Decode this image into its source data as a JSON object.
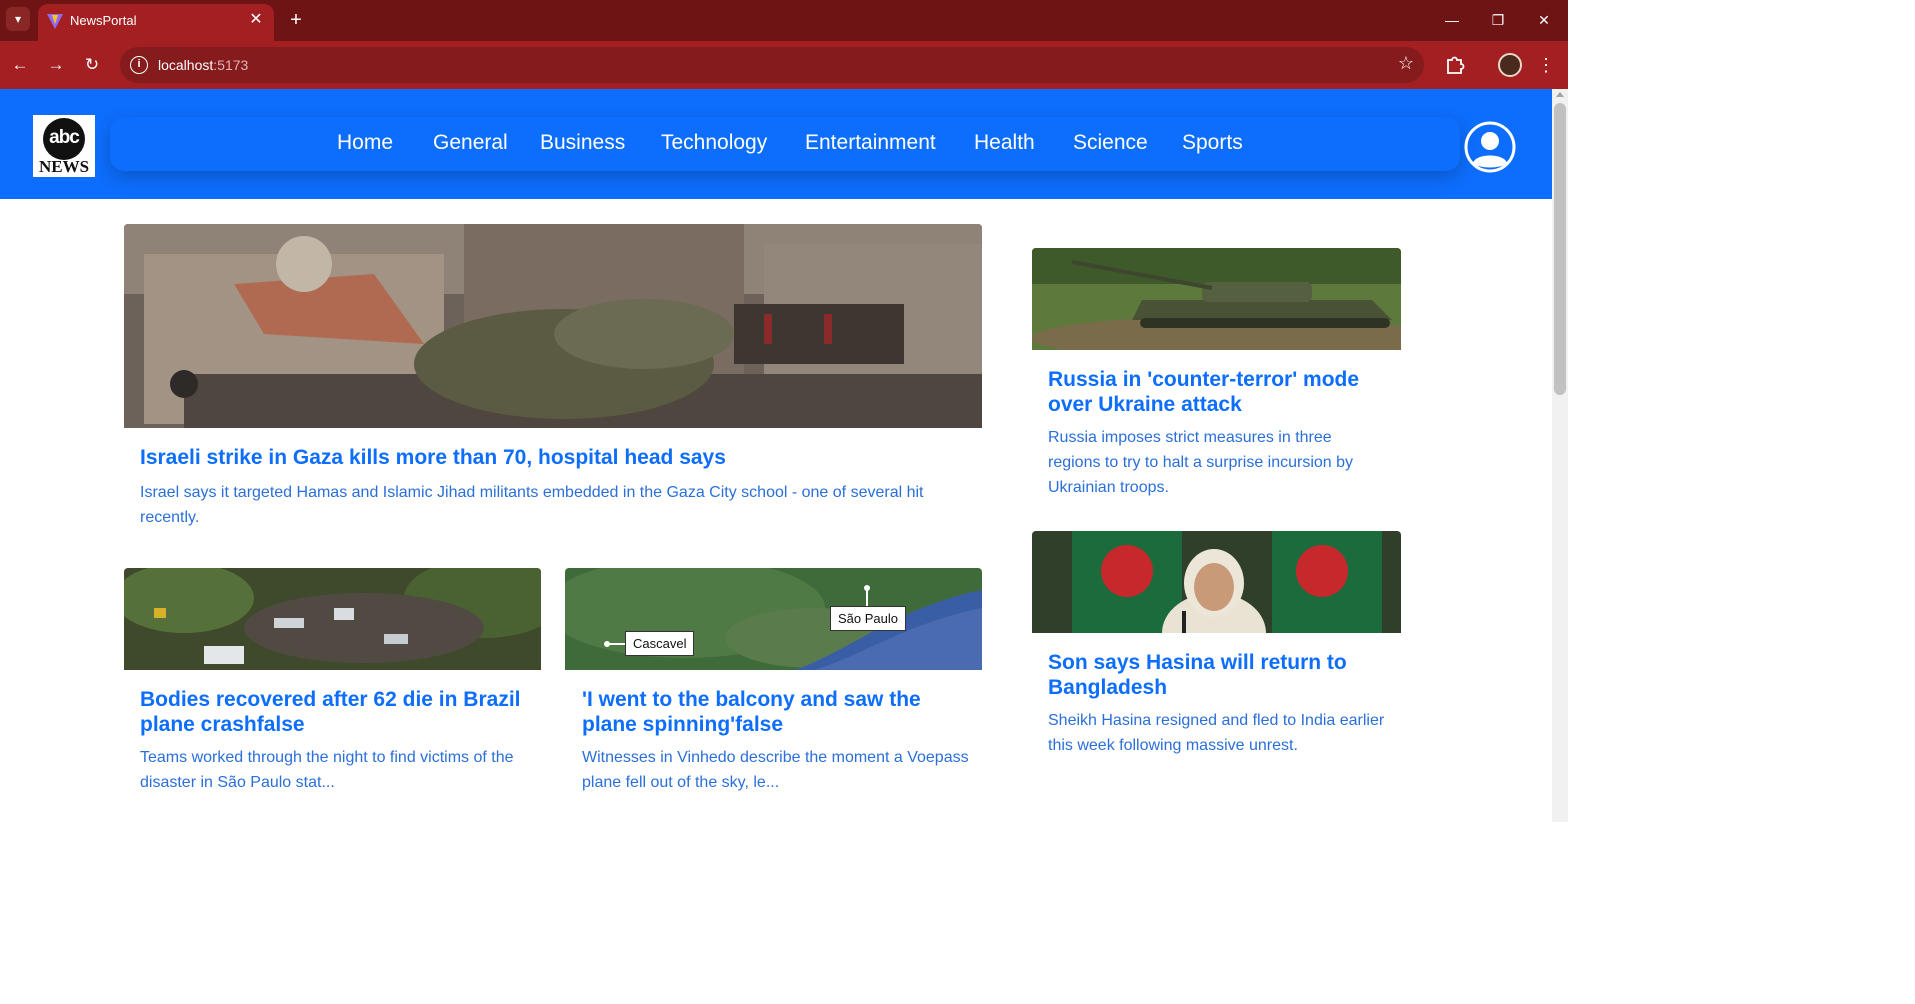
{
  "browser": {
    "tab_title": "NewsPortal",
    "tab_close": "✕",
    "new_tab": "+",
    "url_host": "localhost",
    "url_port": ":5173"
  },
  "site": {
    "logo_mark": "abc",
    "logo_text": "NEWS",
    "nav": [
      "Home",
      "General",
      "Business",
      "Technology",
      "Entertainment",
      "Health",
      "Science",
      "Sports"
    ]
  },
  "articles": {
    "hero": {
      "title": "Israeli strike in Gaza kills more than 70, hospital head says",
      "desc": "Israel says it targeted Hamas and Islamic Jihad militants embedded in the Gaza City school - one of several hit recently."
    },
    "small1": {
      "title": "Bodies recovered after 62 die in Brazil plane crashfalse",
      "desc": "Teams worked through the night to find victims of the disaster in São Paulo stat..."
    },
    "small2": {
      "title": "'I went to the balcony and saw the plane spinning'false",
      "desc": "Witnesses in Vinhedo describe the moment a Voepass plane fell out of the sky, le...",
      "map_label_a": "São Paulo",
      "map_label_b": "Cascavel"
    },
    "side1": {
      "title": "Russia in 'counter-terror' mode over Ukraine attack",
      "desc": "Russia imposes strict measures in three regions to try to halt a surprise incursion by Ukrainian troops."
    },
    "side2": {
      "title": "Son says Hasina will return to Bangladesh",
      "desc": "Sheikh Hasina resigned and fled to India earlier this week following massive unrest."
    }
  },
  "colors": {
    "brand_blue": "#0d6efd",
    "chrome_dark": "#6e1414",
    "chrome": "#a41f21"
  }
}
